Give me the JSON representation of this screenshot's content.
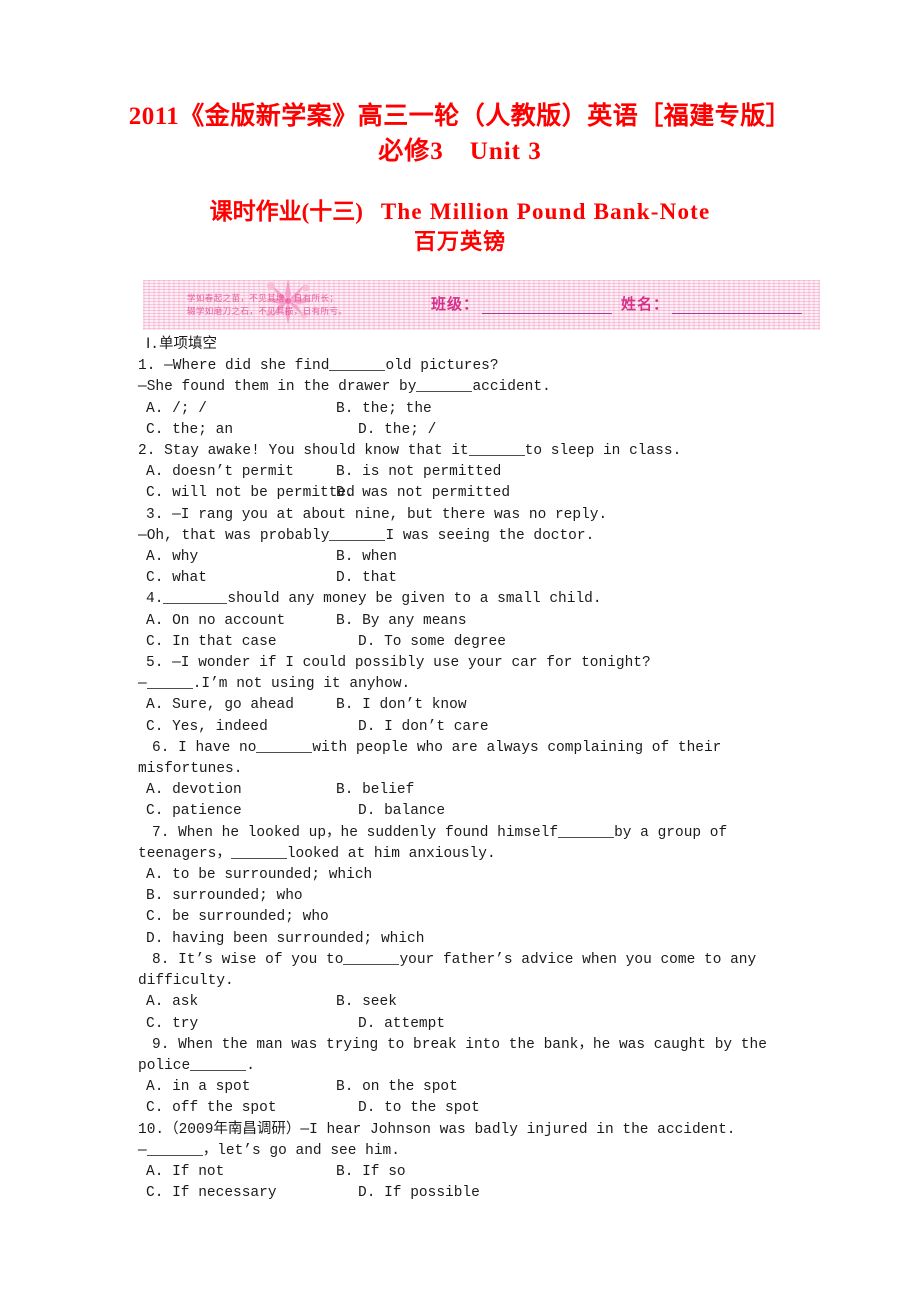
{
  "title": {
    "line1": "2011《金版新学案》高三一轮（人教版）英语［福建专版］",
    "line2_a": "必修3",
    "line2_b": "Unit 3"
  },
  "subtitle": {
    "cn": "课时作业(十三)",
    "en": "The Million Pound Bank-Note",
    "cn2": "百万英镑"
  },
  "banner": {
    "proverb_line1": "学如春起之苗，不见其增，日有所长；",
    "proverb_line2": "辍学如磨刀之石，不见其损，日有所亏。",
    "class_label": "班级：",
    "name_label": "姓名：",
    "sparkle_icon": "sparkle-flower-icon",
    "stripe_color": "#f6a0c8",
    "label_color": "#d6308a"
  },
  "section": {
    "heading": "Ⅰ.单项填空"
  },
  "questions": [
    {
      "num": "1.",
      "stem_lines": [
        {
          "pre": "1. —Where did she find",
          "blank": "b-md",
          "post": "old pictures?"
        },
        {
          "pre": "—She found them in the drawer by",
          "blank": "b-md",
          "post": "accident."
        }
      ],
      "options": [
        {
          "left": "A. /; /",
          "right": "B. the; the",
          "width": "opt-left"
        },
        {
          "left": "C. the; an",
          "right": "D. the; /",
          "width": "opt-left wide"
        }
      ]
    },
    {
      "num": "2.",
      "stem_lines": [
        {
          "pre": "2. Stay awake! You should know that it",
          "blank": "b-md",
          "post": "to sleep in class."
        }
      ],
      "options": [
        {
          "left": "A. doesn’t permit",
          "right": "B. is not permitted",
          "width": "opt-left"
        },
        {
          "left": "C. will not be permitted",
          "right": "D. was not permitted",
          "width": "opt-left"
        }
      ]
    },
    {
      "num": "3.",
      "stem_lines": [
        {
          "pre": "3. —I rang you at about nine, but there was no reply.",
          "blank": "",
          "post": ""
        },
        {
          "pre": "—Oh, that was probably",
          "blank": "b-md",
          "post": "I was seeing the doctor."
        }
      ],
      "options": [
        {
          "left": "A. why",
          "right": "B. when",
          "width": "opt-left"
        },
        {
          "left": "C. what",
          "right": "D. that",
          "width": "opt-left"
        }
      ]
    },
    {
      "num": "4.",
      "stem_lines": [
        {
          "pre": "4.",
          "blank": "b-lg",
          "post": "should any money be given to a small child."
        }
      ],
      "options": [
        {
          "left": "A. On no account",
          "right": "B. By any means",
          "width": "opt-left"
        },
        {
          "left": "C. In that case",
          "right": "D. To some degree",
          "width": "opt-left wide"
        }
      ]
    },
    {
      "num": "5.",
      "stem_lines": [
        {
          "pre": "5. —I wonder if I could possibly use your car for tonight?",
          "blank": "",
          "post": ""
        },
        {
          "pre": "—",
          "blank": "b-sm",
          "post": ".I’m not using it anyhow."
        }
      ],
      "options": [
        {
          "left": "A. Sure, go ahead",
          "right": "B. I don’t know",
          "width": "opt-left"
        },
        {
          "left": "C. Yes, indeed",
          "right": "D. I don’t care",
          "width": "opt-left wide"
        }
      ]
    },
    {
      "num": "6.",
      "justified": {
        "pre": "6. I have no",
        "blank": "b-md",
        "post": "with people who are always complaining of their",
        "tail": "misfortunes."
      },
      "options": [
        {
          "left": "A. devotion",
          "right": "B. belief",
          "width": "opt-left"
        },
        {
          "left": "C. patience",
          "right": "D. balance",
          "width": "opt-left wide"
        }
      ]
    },
    {
      "num": "7.",
      "justified": {
        "pre": "7. When he looked up，he suddenly found himself",
        "blank": "b-md",
        "post": "by a group of",
        "tail_pre": "teenagers，",
        "tail_blank": "b-md",
        "tail_post": "looked at him anxiously."
      },
      "options_stacked": [
        "A. to be surrounded; which",
        "B. surrounded; who",
        "C. be surrounded; who",
        "D. having been surrounded; which"
      ]
    },
    {
      "num": "8.",
      "justified": {
        "pre": "8. It’s wise of you to",
        "blank": "b-md",
        "post": "your father’s advice when you come to any",
        "tail": "difficulty."
      },
      "options": [
        {
          "left": "A. ask",
          "right": "B. seek",
          "width": "opt-left"
        },
        {
          "left": "C. try",
          "right": "D. attempt",
          "width": "opt-left wide"
        }
      ]
    },
    {
      "num": "9.",
      "justified": {
        "pre": "9. When the man was trying to break into the bank，he was caught by the",
        "tail_pre": "police",
        "tail_blank": "b-md",
        "tail_post": "."
      },
      "options": [
        {
          "left": "A. in a spot",
          "right": "B. on the spot",
          "width": "opt-left"
        },
        {
          "left": "C. off the spot",
          "right": "D. to the spot",
          "width": "opt-left wide"
        }
      ]
    },
    {
      "num": "10.",
      "stem_lines": [
        {
          "pre": "10.（2009年南昌调研）—I hear Johnson was badly injured in the accident.",
          "blank": "",
          "post": ""
        },
        {
          "pre": "—",
          "blank": "b-md",
          "post": "，let’s go and see him."
        }
      ],
      "options": [
        {
          "left": "A. If not",
          "right": "B. If so",
          "width": "opt-left"
        },
        {
          "left": "C. If necessary",
          "right": "D. If possible",
          "width": "opt-left wide"
        }
      ]
    }
  ]
}
